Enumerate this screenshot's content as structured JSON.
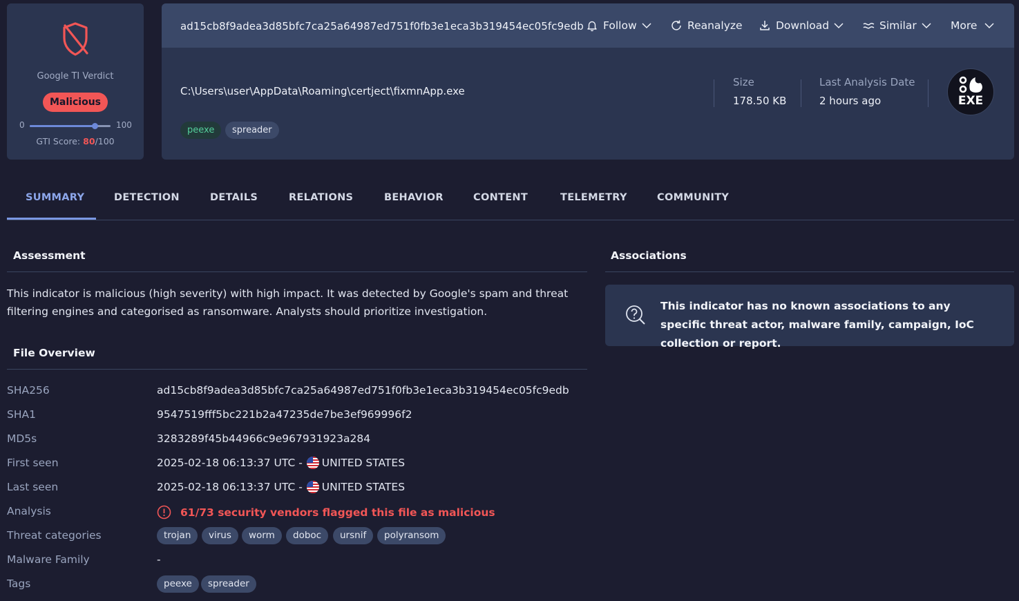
{
  "verdict": {
    "label": "Google TI Verdict",
    "badge": "Malicious",
    "scale_min": "0",
    "scale_max": "100",
    "score_prefix": "GTI Score: ",
    "score": "80",
    "score_suffix": "/100",
    "score_fraction": 0.8
  },
  "header": {
    "hash": "ad15cb8f9adea3d85bfc7ca25a64987ed751f0fb3e1eca3b319454ec05fc9edb",
    "actions": {
      "follow": "Follow",
      "reanalyze": "Reanalyze",
      "download": "Download",
      "similar": "Similar",
      "more": "More"
    },
    "path": "C:\\Users\\user\\AppData\\Roaming\\certject\\fixmnApp.exe",
    "tags": [
      "peexe",
      "spreader"
    ],
    "size_label": "Size",
    "size_value": "178.50 KB",
    "date_label": "Last Analysis Date",
    "date_value": "2 hours ago",
    "filetype": "EXE"
  },
  "tabs": [
    "SUMMARY",
    "DETECTION",
    "DETAILS",
    "RELATIONS",
    "BEHAVIOR",
    "CONTENT",
    "TELEMETRY",
    "COMMUNITY"
  ],
  "assessment": {
    "title": "Assessment",
    "text": "This indicator is malicious (high severity) with high impact. It was detected by Google's spam and threat filtering engines and categorised as ransomware. Analysts should prioritize investigation."
  },
  "associations": {
    "title": "Associations",
    "text": "This indicator has no known associations to any specific threat actor, malware family, campaign, IoC collection or report."
  },
  "overview": {
    "title": "File Overview",
    "sha256_label": "SHA256",
    "sha256": "ad15cb8f9adea3d85bfc7ca25a64987ed751f0fb3e1eca3b319454ec05fc9edb",
    "sha1_label": "SHA1",
    "sha1": "9547519fff5bc221b2a47235de7be3ef969996f2",
    "md5_label": "MD5s",
    "md5": "3283289f45b44966c9e967931923a284",
    "first_seen_label": "First seen",
    "first_seen": "2025-02-18 06:13:37 UTC - ",
    "first_seen_country": "UNITED STATES",
    "last_seen_label": "Last seen",
    "last_seen": "2025-02-18 06:13:37 UTC - ",
    "last_seen_country": "UNITED STATES",
    "analysis_label": "Analysis",
    "analysis": "61/73 security vendors flagged this file as malicious",
    "threat_label": "Threat categories",
    "threats": [
      "trojan",
      "virus",
      "worm",
      "doboc",
      "ursnif",
      "polyransom"
    ],
    "family_label": "Malware Family",
    "family": "-",
    "tags_label": "Tags",
    "tags": [
      "peexe",
      "spreader"
    ]
  },
  "colors": {
    "malicious": "#f25656",
    "accent": "#7b98e3",
    "card": "#2b3550",
    "background": "#1c1d30"
  }
}
